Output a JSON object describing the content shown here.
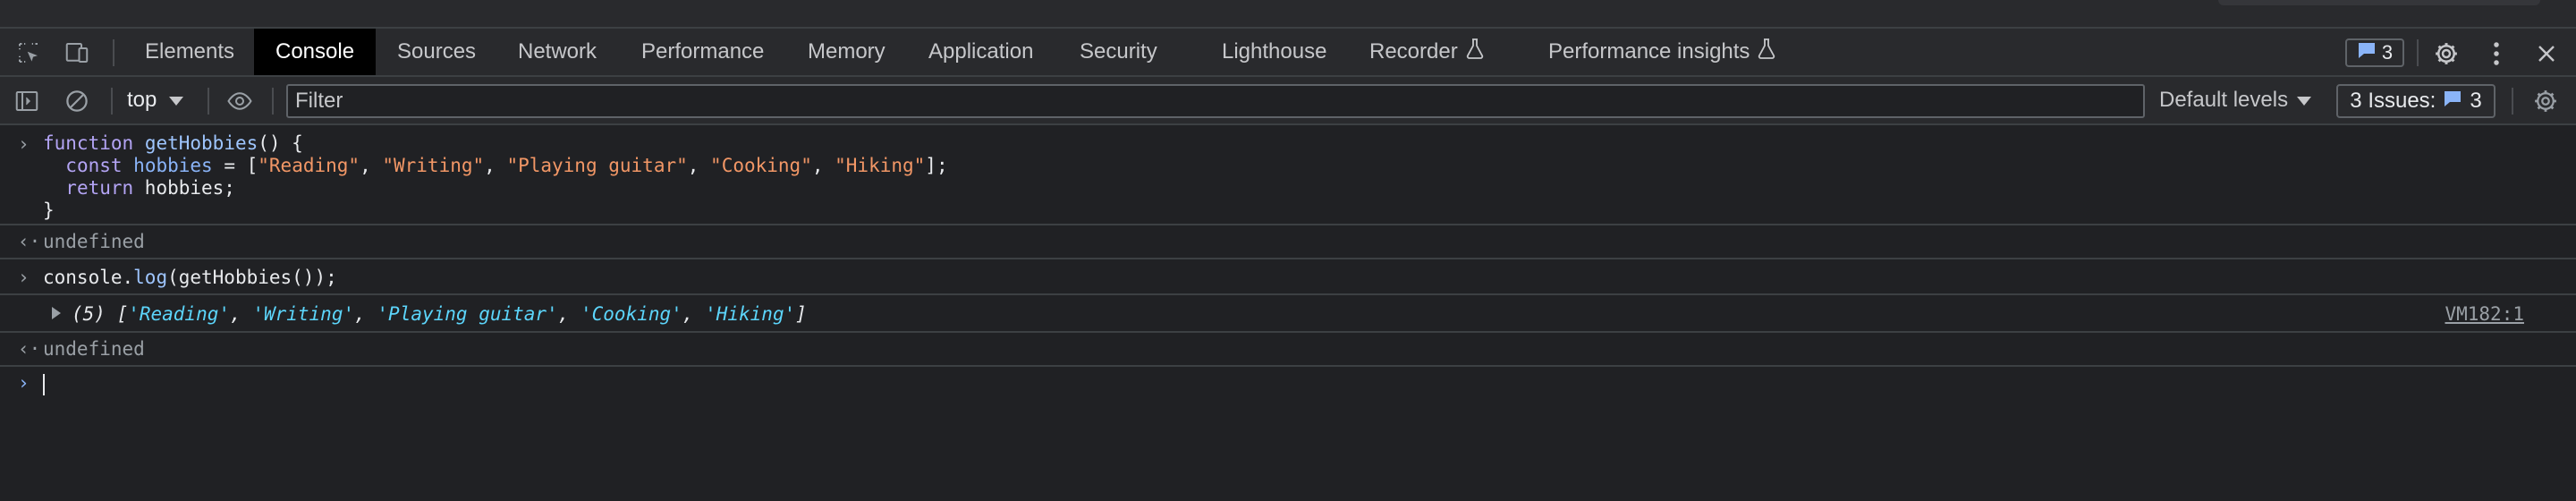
{
  "tabs": [
    {
      "label": "Elements",
      "active": false
    },
    {
      "label": "Console",
      "active": true
    },
    {
      "label": "Sources",
      "active": false
    },
    {
      "label": "Network",
      "active": false
    },
    {
      "label": "Performance",
      "active": false
    },
    {
      "label": "Memory",
      "active": false
    },
    {
      "label": "Application",
      "active": false
    },
    {
      "label": "Security",
      "active": false
    },
    {
      "label": "Lighthouse",
      "active": false
    },
    {
      "label": "Recorder",
      "active": false
    },
    {
      "label": "Performance insights",
      "active": false
    }
  ],
  "issues_badge_count": "3",
  "toolbar": {
    "context": "top",
    "filter_placeholder": "Filter",
    "levels": "Default levels",
    "issues_label": "3 Issues:",
    "issues_count": "3"
  },
  "console": {
    "entry1": {
      "l1_kw": "function",
      "l1_fn": "getHobbies",
      "l1_rest": "() {",
      "l2_kw": "const",
      "l2_var": "hobbies",
      "l2_eq": " = [",
      "s1": "\"Reading\"",
      "s2": "\"Writing\"",
      "s3": "\"Playing guitar\"",
      "s4": "\"Cooking\"",
      "s5": "\"Hiking\"",
      "l2_end": "];",
      "l3_kw": "return",
      "l3_rest": " hobbies;",
      "l4": "}"
    },
    "result1": "undefined",
    "entry2": {
      "obj": "console.",
      "fn": "log",
      "rest": "(getHobbies());"
    },
    "log": {
      "prefix": "(5) [",
      "items": [
        "'Reading'",
        "'Writing'",
        "'Playing guitar'",
        "'Cooking'",
        "'Hiking'"
      ],
      "suffix": "]",
      "source": "VM182:1"
    },
    "result2": "undefined"
  },
  "colors": {
    "background": "#202124",
    "toolbar": "#292a2d",
    "string": "#f29766",
    "array_string": "#5cd5fb",
    "accent": "#8ab4f8"
  }
}
